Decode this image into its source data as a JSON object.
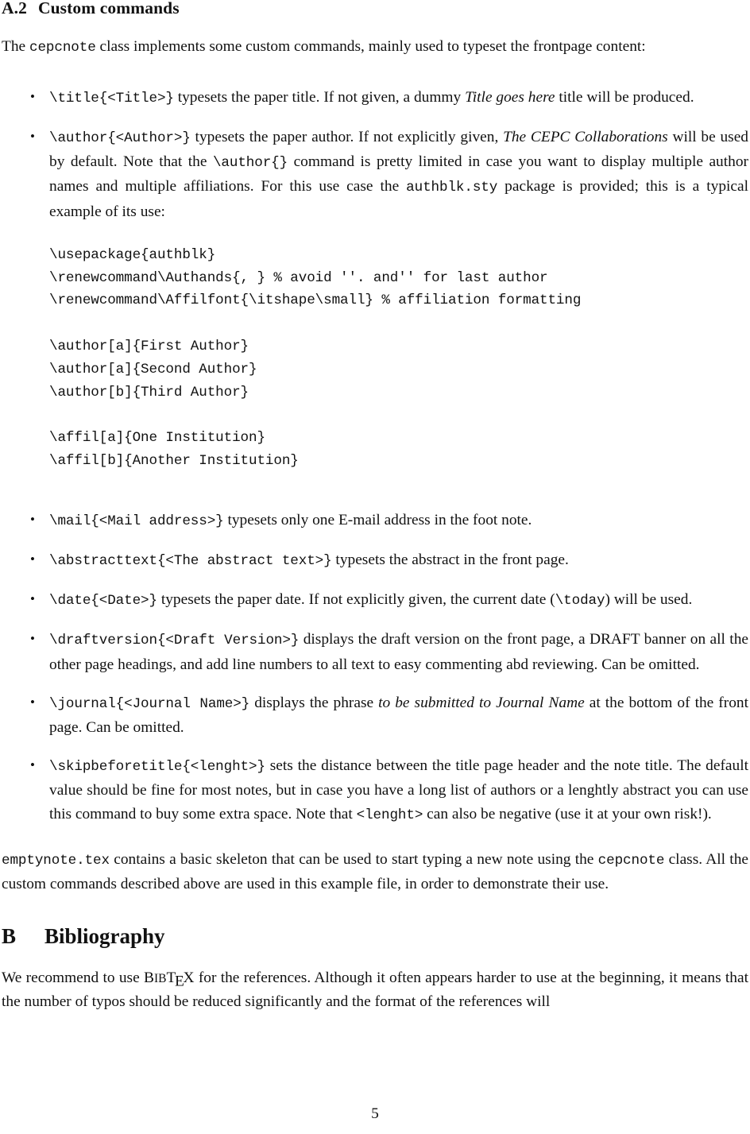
{
  "document": {
    "page_number": "5",
    "subsection": {
      "number": "A.2",
      "title": "Custom commands"
    },
    "intro_paragraph": {
      "before_code": "The ",
      "code": "cepcnote",
      "after_code": " class implements some custom commands, mainly used to typeset the frontpage content:"
    },
    "commands": [
      {
        "id": "title",
        "code": "\\title{<Title>}",
        "text_1": " typesets the paper title.  If not given, a dummy ",
        "italic_1": "Title goes here",
        "text_2": " title will be produced."
      },
      {
        "id": "author",
        "code": "\\author{<Author>}",
        "text_1": " typesets the paper author. If not explicitly given, ",
        "italic_1": "The CEPC Collaborations",
        "text_2": " will be used by default.  Note that the ",
        "code_2": "\\author{}",
        "text_3": " command is pretty limited in case you want to display multiple author names and multiple affiliations.  For this use case the ",
        "code_3": "authblk.sty",
        "text_4": " package is provided; this is a typical example of its use:"
      },
      {
        "id": "mail",
        "code": "\\mail{<Mail address>}",
        "text_1": " typesets only one E-mail address in the foot note."
      },
      {
        "id": "abstracttext",
        "code": "\\abstracttext{<The abstract text>}",
        "text_1": " typesets the abstract in the front page."
      },
      {
        "id": "date",
        "code": "\\date{<Date>}",
        "text_1": " typesets the paper date. If not explicitly given, the current date (",
        "code_2": "\\today",
        "text_2": ") will be used."
      },
      {
        "id": "draftversion",
        "code": "\\draftversion{<Draft Version>}",
        "text_1": " displays the draft version on the front page, a DRAFT banner on all the other page headings, and add line numbers to all text to easy commenting abd reviewing. Can be omitted."
      },
      {
        "id": "journal",
        "code": "\\journal{<Journal Name>}",
        "text_1": " displays the phrase ",
        "italic_1": "to be submitted to Journal Name",
        "text_2": " at the bottom of the front page. Can be omitted."
      },
      {
        "id": "skipbeforetitle",
        "code": "\\skipbeforetitle{<lenght>}",
        "text_1": " sets the distance between the title page header and the note title. The default value should be fine for most notes, but in case you have a long list of authors or a lenghtly abstract you can use this command to buy some extra space. Note that ",
        "code_2": "<lenght>",
        "text_2": " can also be negative (use it at your own risk!)."
      }
    ],
    "code_block": "\\usepackage{authblk}\n\\renewcommand\\Authands{, } % avoid ''. and'' for last author\n\\renewcommand\\Affilfont{\\itshape\\small} % affiliation formatting\n\n\\author[a]{First Author}\n\\author[a]{Second Author}\n\\author[b]{Third Author}\n\n\\affil[a]{One Institution}\n\\affil[b]{Another Institution}",
    "closing_paragraph": {
      "code_1": "emptynote.tex",
      "text_1": " contains a basic skeleton that can be used to start typing a new note using the ",
      "code_2": "cepcnote",
      "text_2": " class.  All the custom commands described above are used in this example file, in order to demonstrate their use."
    },
    "section": {
      "number": "B",
      "title": "Bibliography"
    },
    "bibliography_paragraph": {
      "text_1": "We recommend to use ",
      "logo": "BibTeX",
      "logo_parts": {
        "b1": "B",
        "ib": "IB",
        "t": "T",
        "e": "E",
        "x": "X"
      },
      "text_2": " for the references.  Although it often appears harder to use at the beginning, it means that the number of typos should be reduced significantly and the format of the references will"
    }
  }
}
